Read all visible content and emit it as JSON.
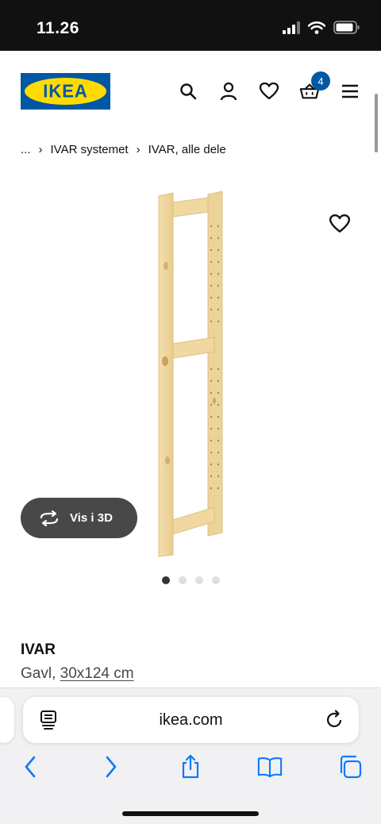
{
  "status_bar": {
    "time": "11.26"
  },
  "header": {
    "logo_text": "IKEA",
    "cart_count": "4",
    "icons": [
      "search-icon",
      "profile-icon",
      "heart-icon",
      "cart-icon",
      "menu-icon"
    ]
  },
  "breadcrumb": {
    "items": [
      {
        "label": "..."
      },
      {
        "label": "IVAR systemet"
      },
      {
        "label": "IVAR, alle dele"
      }
    ],
    "separator": "›"
  },
  "product": {
    "image_dots": {
      "count": 4,
      "active_index": 0
    },
    "view_3d_label": "Vis i 3D",
    "name": "IVAR",
    "type": "Gavl, ",
    "dimensions": "30x124 cm",
    "wood_color": "#f0d9a4"
  },
  "browser": {
    "url": "ikea.com"
  },
  "colors": {
    "brand_blue": "#0058a3",
    "brand_yellow": "#ffdb00",
    "pill_bg": "#484848"
  }
}
